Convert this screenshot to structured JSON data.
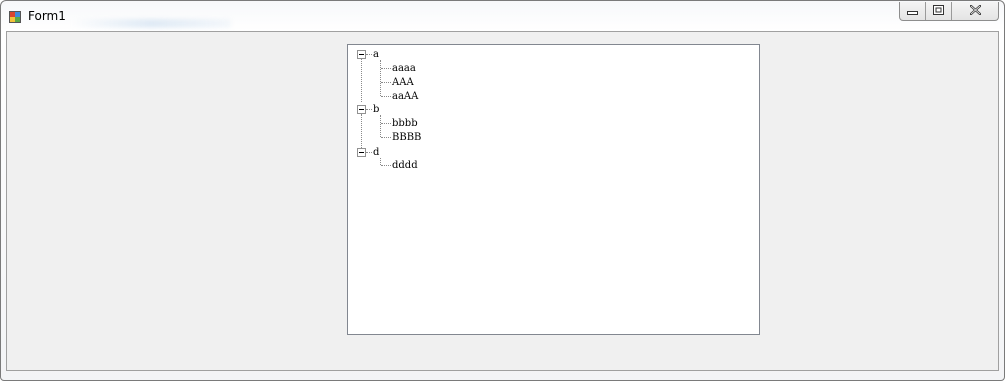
{
  "window": {
    "title": "Form1"
  },
  "tree": {
    "nodes": [
      {
        "label": "a",
        "children": [
          "aaaa",
          "AAA",
          "aaAA"
        ]
      },
      {
        "label": "b",
        "children": [
          "bbbb",
          "BBBB"
        ]
      },
      {
        "label": "d",
        "children": [
          "dddd"
        ]
      }
    ]
  },
  "icons": {
    "app": "form-app-icon",
    "minimize": "minimize-icon",
    "maximize": "maximize-icon",
    "close": "close-icon",
    "collapse": "collapse-minus-icon"
  }
}
